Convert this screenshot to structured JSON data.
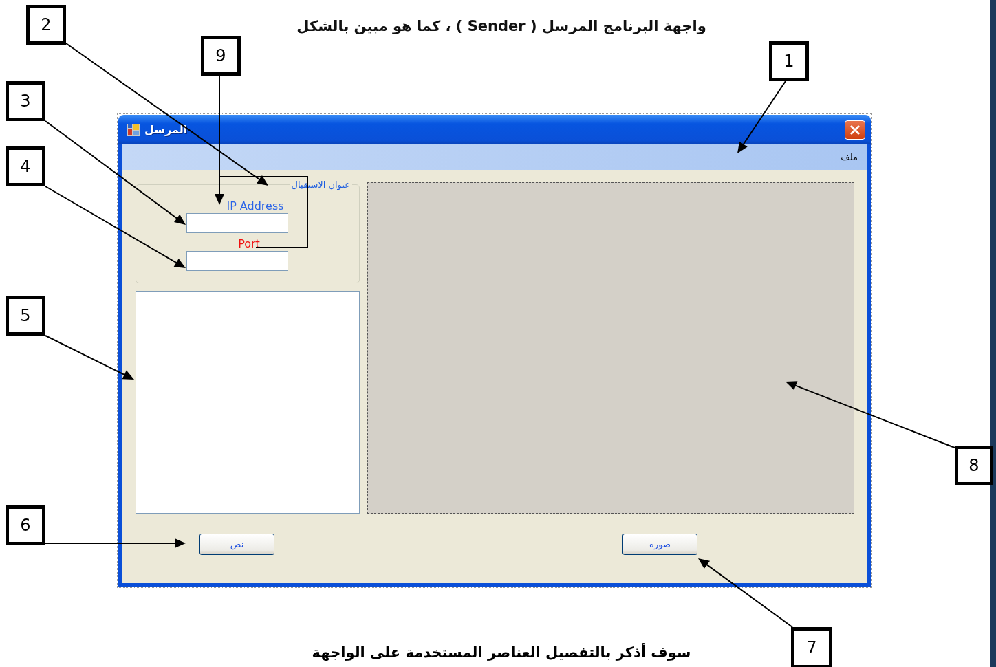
{
  "heading": "واجهة البرنامج المرسل ( Sender ) ، كما هو مبين بالشكل",
  "callouts": [
    "2",
    "9",
    "1",
    "3",
    "4",
    "5",
    "8",
    "6",
    "7"
  ],
  "window": {
    "title": "المرسل",
    "menu": [
      "ملف"
    ],
    "group": {
      "legend": "عنوان الاستقبال",
      "ip_label": "IP Address",
      "port_label": "Port"
    },
    "buttons": [
      "صورة",
      "نص"
    ]
  },
  "caption": "سوف أذكر بالتفصيل العناصر المستخدمة على الواجهة"
}
